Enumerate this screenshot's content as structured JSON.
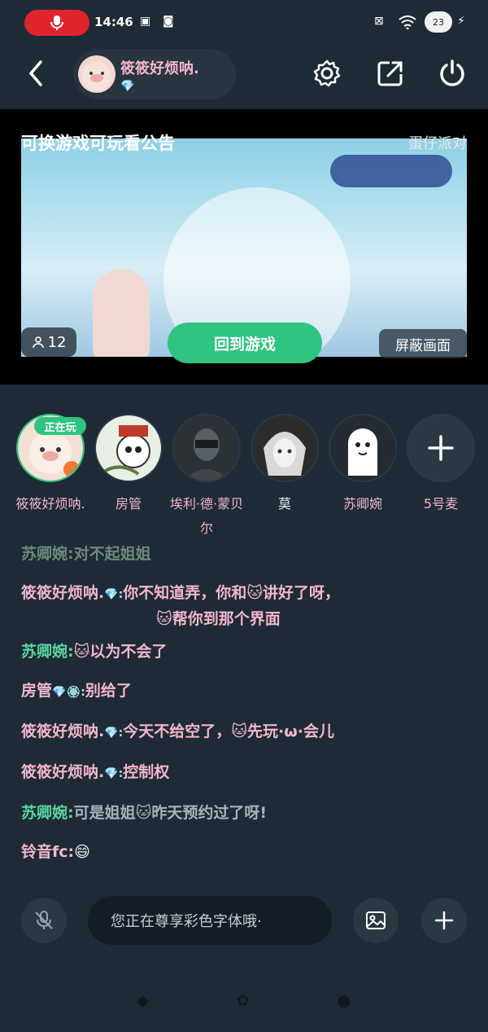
{
  "status_bar": {
    "time": "14:46",
    "battery": "23"
  },
  "header": {
    "room_name": "筱筱好烦呐.",
    "badge": "💎"
  },
  "video": {
    "notice": "可换游戏可玩看公告",
    "game_name": "蛋仔派对",
    "viewer_count": "12",
    "return_label": "回到游戏",
    "block_label": "屏蔽画面"
  },
  "seats": [
    {
      "name": "筱筱好烦呐.",
      "playing": "正在玩"
    },
    {
      "name": "房管"
    },
    {
      "name": "埃利·德·蒙贝尔"
    },
    {
      "name": "莫"
    },
    {
      "name": "苏卿婉"
    },
    {
      "name": "5号麦"
    }
  ],
  "chat": [
    {
      "user": "苏卿婉:",
      "text": "对不起姐姐"
    },
    {
      "user": "筱筱好烦呐.",
      "badge": "💎:",
      "text": "你不知道弄，你和🐱讲好了呀，",
      "cont": "🐱帮你到那个界面"
    },
    {
      "user": "苏卿婉:",
      "text": "🐱以为不会了"
    },
    {
      "user": "房管",
      "badge": "💎🏵:",
      "text": "别给了"
    },
    {
      "user": "筱筱好烦呐.",
      "badge": "💎:",
      "text": "今天不给空了，🐱先玩·ω·会儿"
    },
    {
      "user": "筱筱好烦呐.",
      "badge": "💎:",
      "text": "控制权"
    },
    {
      "user": "苏卿婉:",
      "text": "可是姐姐🐱昨天预约过了呀!"
    },
    {
      "user": "铃音fc:",
      "text": "😄"
    }
  ],
  "input": {
    "placeholder": "您正在尊享彩色字体哦·"
  }
}
